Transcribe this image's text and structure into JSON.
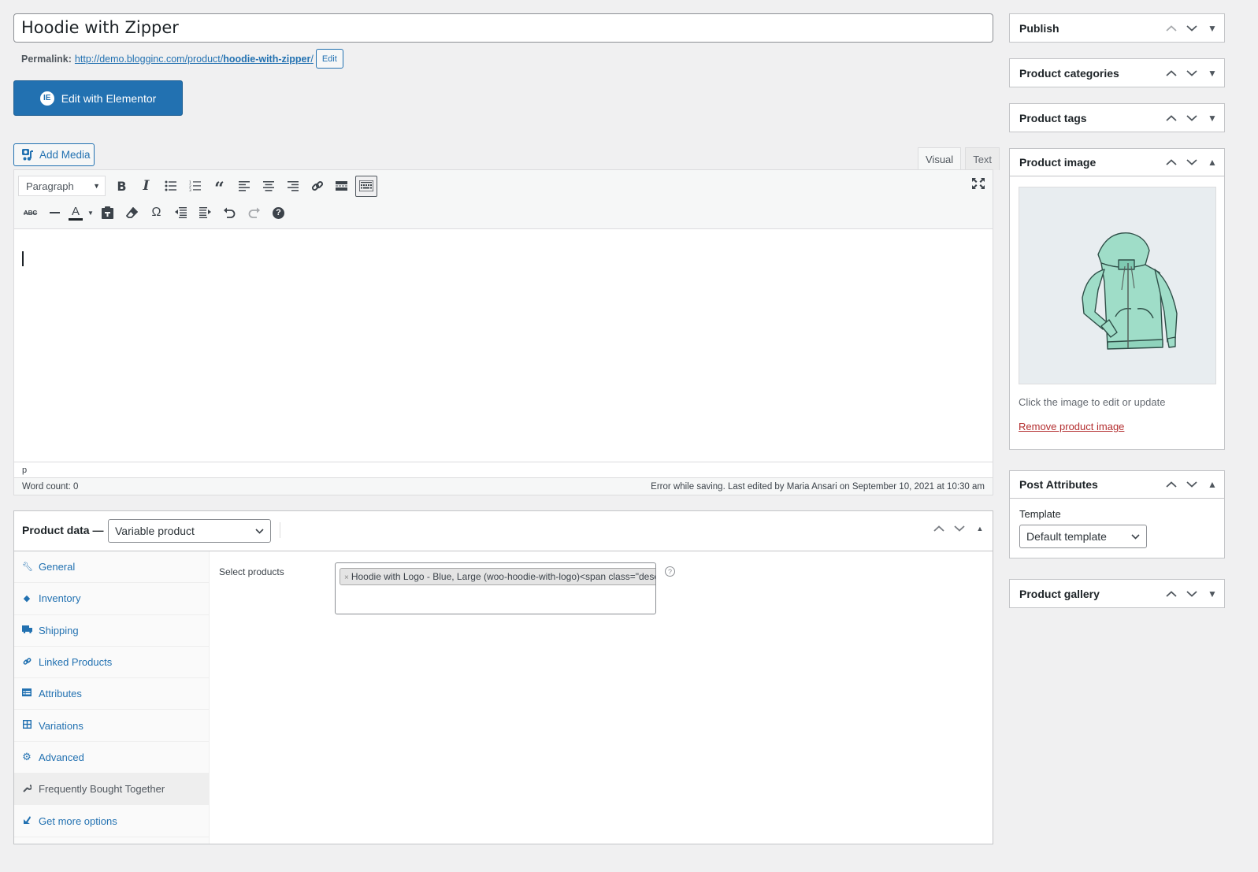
{
  "post": {
    "title": "Hoodie with Zipper",
    "permalink_label": "Permalink:",
    "permalink_base": "http://demo.blogginc.com/product/",
    "permalink_slug": "hoodie-with-zipper",
    "permalink_trailing": "/",
    "permalink_edit": "Edit"
  },
  "elementor": {
    "label": "Edit with Elementor",
    "logo": "IE"
  },
  "editor": {
    "add_media": "Add Media",
    "tabs": [
      {
        "label": "Visual",
        "active": true
      },
      {
        "label": "Text",
        "active": false
      }
    ],
    "format_select": "Paragraph",
    "toolbar_row1": [
      "bold",
      "italic",
      "bulleted-list",
      "numbered-list",
      "blockquote",
      "align-left",
      "align-center",
      "align-right",
      "insert-link",
      "read-more",
      "toolbar-toggle"
    ],
    "toolbar_row2": [
      "strikethrough",
      "horizontal-line",
      "text-color",
      "paste-as-text",
      "clear-formatting",
      "special-character",
      "outdent",
      "indent",
      "undo",
      "redo",
      "keyboard-shortcuts"
    ],
    "path": "p",
    "word_count": "Word count: 0",
    "save_status": "Error while saving. Last edited by Maria Ansari on September 10, 2021 at 10:30 am"
  },
  "product_data": {
    "title": "Product data —",
    "type": "Variable product",
    "tabs": [
      {
        "label": "General",
        "icon": "wrench-icon"
      },
      {
        "label": "Inventory",
        "icon": "tag-icon"
      },
      {
        "label": "Shipping",
        "icon": "truck-icon"
      },
      {
        "label": "Linked Products",
        "icon": "link-icon"
      },
      {
        "label": "Attributes",
        "icon": "list-icon"
      },
      {
        "label": "Variations",
        "icon": "grid-icon"
      },
      {
        "label": "Advanced",
        "icon": "gear-icon"
      },
      {
        "label": "Frequently Bought Together",
        "icon": "wrench-icon",
        "active": true
      },
      {
        "label": "Get more options",
        "icon": "plugin-icon"
      }
    ],
    "select_products_label": "Select products",
    "selected_product": "Hoodie with Logo - Blue, Large (woo-hoodie-with-logo)<span class=\"description\">"
  },
  "sidebar": {
    "publish": "Publish",
    "categories": "Product categories",
    "tags": "Product tags",
    "image": {
      "title": "Product image",
      "note": "Click the image to edit or update",
      "remove": "Remove product image",
      "alt": "Mint green zip-up hoodie"
    },
    "attributes": {
      "title": "Post Attributes",
      "template_label": "Template",
      "template_value": "Default template"
    },
    "gallery": "Product gallery"
  }
}
